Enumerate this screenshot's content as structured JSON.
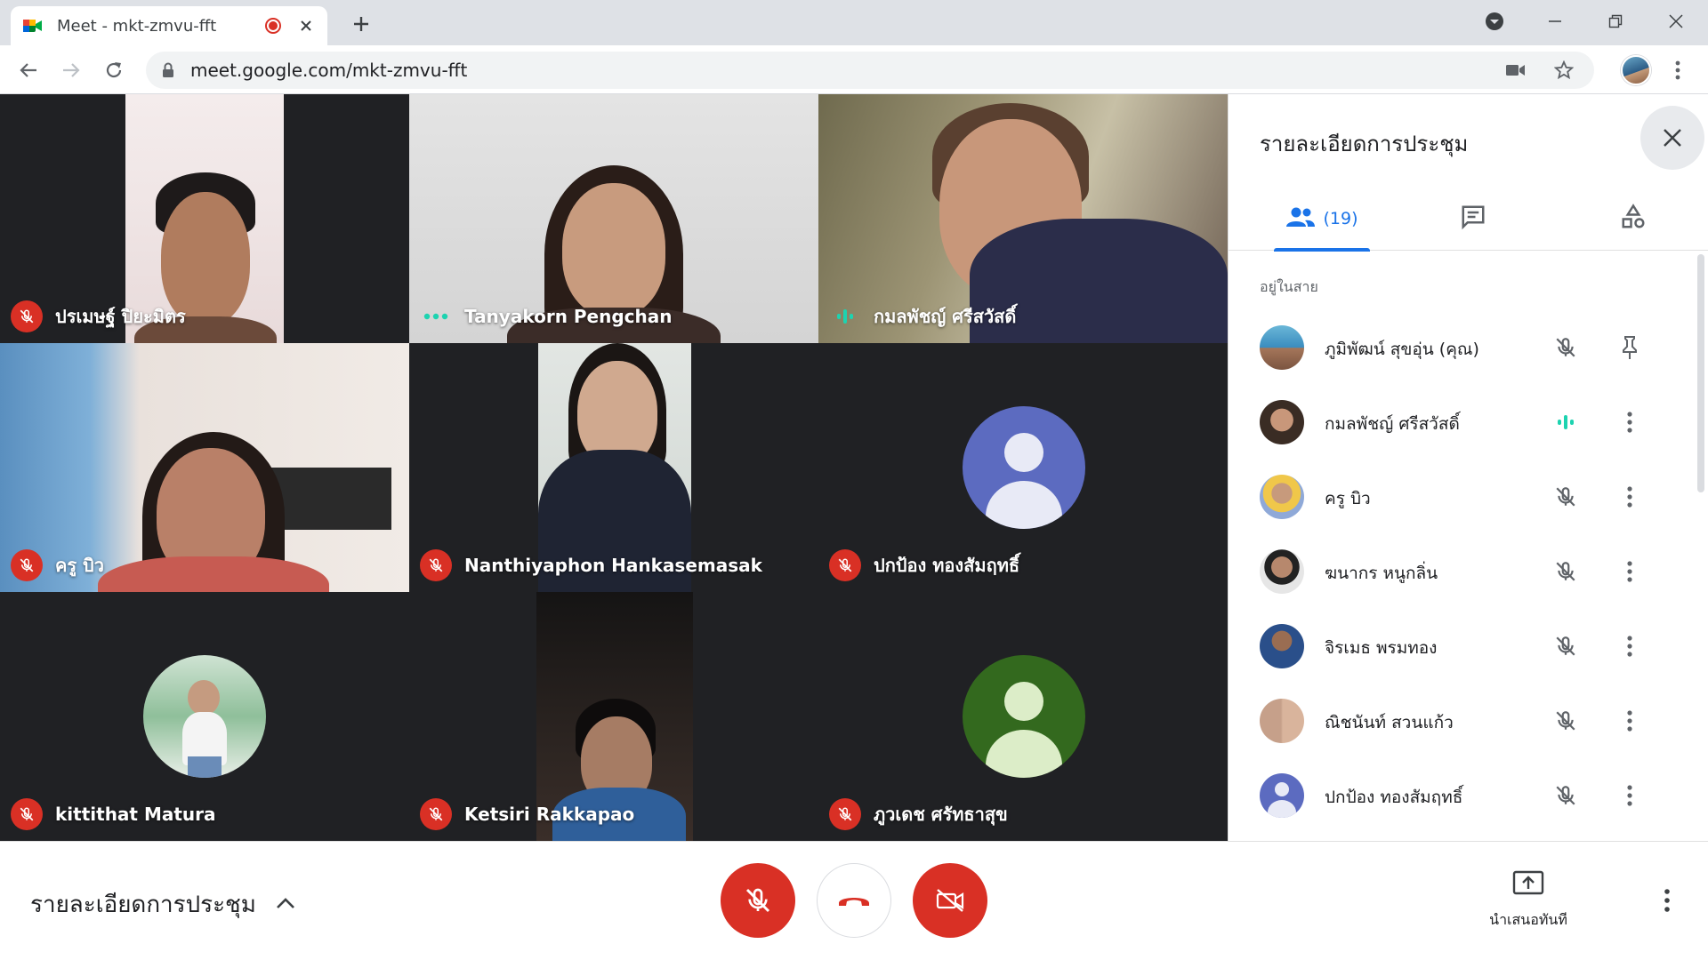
{
  "browser": {
    "tab_title": "Meet - mkt-zmvu-fft",
    "url": "meet.google.com/mkt-zmvu-fft"
  },
  "tiles": [
    {
      "name": "ปรเมษฐ์ ปิยะมิตร",
      "status": "muted"
    },
    {
      "name": "Tanyakorn Pengchan",
      "status": "dots"
    },
    {
      "name": "กมลพัชญ์ ศรีสวัสดิ์",
      "status": "speaking"
    },
    {
      "name": "ครู บิว",
      "status": "muted"
    },
    {
      "name": "Nanthiyaphon Hankasemasak",
      "status": "muted"
    },
    {
      "name": "ปกป้อง ทองสัมฤทธิ์",
      "status": "muted"
    },
    {
      "name": "kittithat Matura",
      "status": "muted"
    },
    {
      "name": "Ketsiri Rakkapao",
      "status": "muted"
    },
    {
      "name": "ภูวเดช ศรัทธาสุข",
      "status": "muted"
    }
  ],
  "panel": {
    "title": "รายละเอียดการประชุม",
    "people_count": "(19)",
    "section_label": "อยู่ในสาย",
    "participants": [
      {
        "name": "ภูมิพัฒน์ สุขอุ่น (คุณ)",
        "mic": "muted",
        "action": "pin"
      },
      {
        "name": "กมลพัชญ์ ศรีสวัสดิ์",
        "mic": "speaking",
        "action": "more"
      },
      {
        "name": "ครู บิว",
        "mic": "muted",
        "action": "more"
      },
      {
        "name": "ฆนากร หนูกลิ่น",
        "mic": "muted",
        "action": "more"
      },
      {
        "name": "จิรเมธ พรมทอง",
        "mic": "muted",
        "action": "more"
      },
      {
        "name": "ณิชนันท์ สวนแก้ว",
        "mic": "muted",
        "action": "more"
      },
      {
        "name": "ปกป้อง ทองสัมฤทธิ์",
        "mic": "muted",
        "action": "more"
      }
    ]
  },
  "bottombar": {
    "meeting_details": "รายละเอียดการประชุม",
    "present_label": "นำเสนอทันที"
  },
  "colors": {
    "accent_blue": "#1a73e8",
    "alert_red": "#d93025",
    "speaking_teal": "#1dd3b0",
    "grid_bg": "#202124"
  }
}
